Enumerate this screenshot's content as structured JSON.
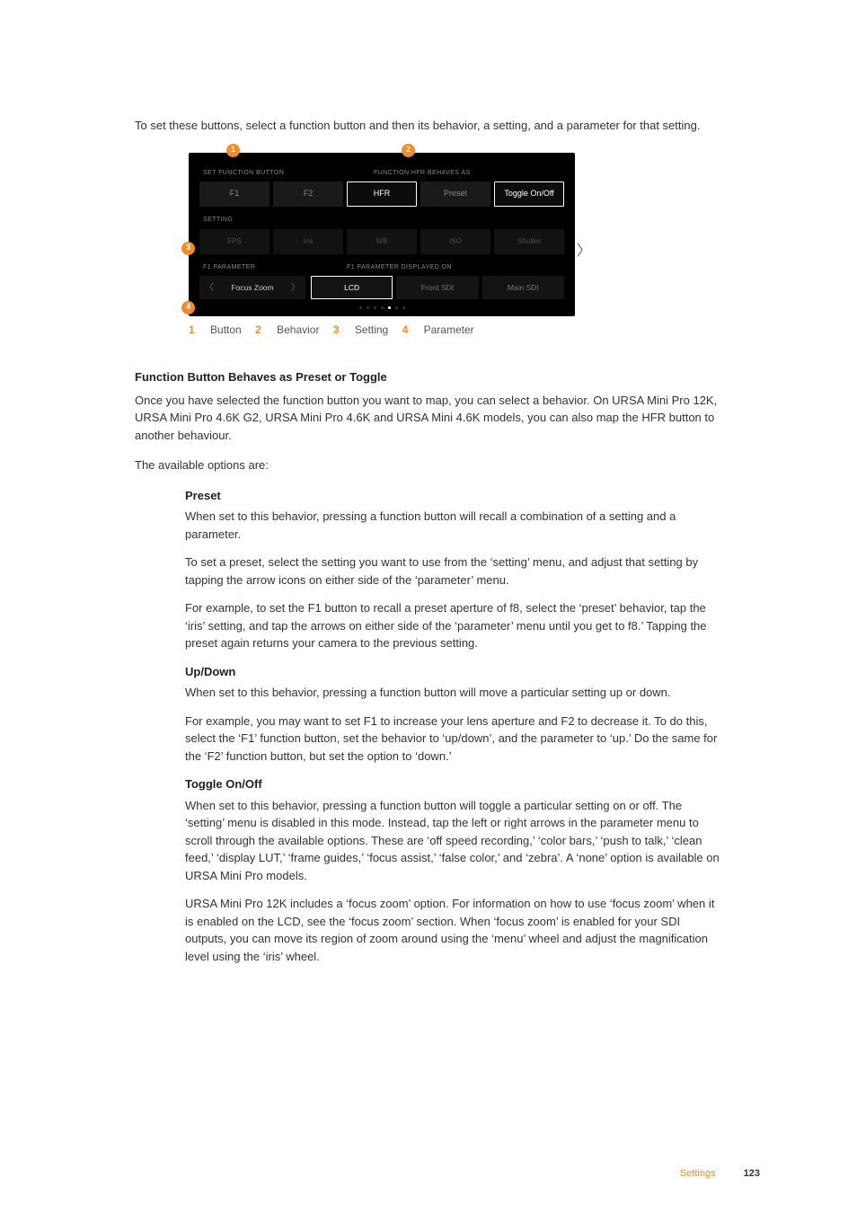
{
  "intro": "To set these buttons, select a function button and then its behavior, a setting, and a parameter for that setting.",
  "figure": {
    "header1": "SET FUNCTION BUTTON",
    "header2": "FUNCTION HFR BEHAVES AS",
    "row1": {
      "F1": "F1",
      "F2": "F2",
      "HFR": "HFR",
      "preset": "Preset",
      "toggle": "Toggle On/Off"
    },
    "settingLabel": "SETTING",
    "settingRow": {
      "fps": "FPS",
      "iris": "Iris",
      "wb": "WB",
      "iso": "ISO",
      "shutter": "Shutter"
    },
    "paramLabel": "F1 PARAMETER",
    "paramDispLabel": "F1 PARAMETER DISPLAYED ON",
    "paramValue": "Focus Zoom",
    "dispOpts": {
      "lcd": "LCD",
      "front": "Front SDI",
      "main": "Main SDI"
    }
  },
  "callouts": {
    "c1": "1",
    "c2": "2",
    "c3": "3",
    "c4": "4"
  },
  "legend": {
    "l1n": "1",
    "l1t": "Button",
    "l2n": "2",
    "l2t": "Behavior",
    "l3n": "3",
    "l3t": "Setting",
    "l4n": "4",
    "l4t": "Parameter"
  },
  "heading1": "Function Button Behaves as Preset or Toggle",
  "p1": "Once you have selected the function button you want to map, you can select a behavior. On URSA Mini Pro 12K, URSA Mini Pro 4.6K G2, URSA Mini Pro 4.6K and URSA Mini 4.6K models, you can also map the HFR button to another behaviour.",
  "p2": "The available options are:",
  "preset": {
    "title": "Preset",
    "p1": "When set to this behavior, pressing a function button will recall a combination of a setting and a parameter.",
    "p2": "To set a preset, select the setting you want to use from the ‘setting’ menu, and adjust that setting by tapping the arrow icons on either side of the ‘parameter’ menu.",
    "p3": "For example, to set the F1 button to recall a preset aperture of f8, select the ‘preset’ behavior, tap the ‘iris’ setting, and tap the arrows on either side of the ‘parameter’ menu until you get to f8.’ Tapping the preset again returns your camera to the previous setting."
  },
  "updown": {
    "title": "Up/Down",
    "p1": "When set to this behavior, pressing a function button will move a particular setting up or down.",
    "p2": "For example, you may want to set F1 to increase your lens aperture and F2 to decrease it. To do this, select the ‘F1’ function button, set the behavior to ‘up/down’, and the parameter to ‘up.’ Do the same for the ‘F2’ function button, but set the option to ‘down.’"
  },
  "toggle": {
    "title": "Toggle On/Off",
    "p1": "When set to this behavior, pressing a function button will toggle a particular setting on or off. The ‘setting’ menu is disabled in this mode. Instead, tap the left or right arrows in the parameter menu to scroll through the available options. These are ‘off speed recording,’ ‘color bars,’ ‘push to talk,’ ‘clean feed,’ ‘display LUT,’ ‘frame guides,’ ‘focus assist,’ ‘false color,’ and ‘zebra’. A ‘none’ option is available on URSA Mini Pro models.",
    "p2": "URSA Mini Pro 12K includes a ‘focus zoom’ option. For information on how to use ‘focus zoom’ when it is enabled on the LCD, see the ‘focus zoom’ section. When ‘focus zoom’ is enabled for your SDI outputs, you can move its region of zoom around using the ‘menu’ wheel and adjust the magnification level using the ‘iris’ wheel."
  },
  "footer": {
    "section": "Settings",
    "page": "123"
  }
}
